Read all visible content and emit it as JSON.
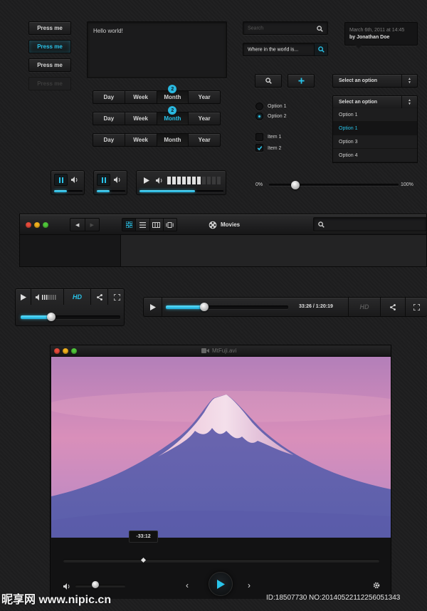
{
  "buttons": {
    "b1": "Press me",
    "b2": "Press me",
    "b3": "Press me",
    "b4": "Press me"
  },
  "textarea": {
    "value": "Hello world!"
  },
  "segmented": [
    {
      "items": [
        "Day",
        "Week",
        "Month",
        "Year"
      ],
      "badge": "2"
    },
    {
      "items": [
        "Day",
        "Week",
        "Month",
        "Year"
      ],
      "badge": "2"
    },
    {
      "items": [
        "Day",
        "Week",
        "Month",
        "Year"
      ]
    }
  ],
  "search": {
    "placeholder": "Search",
    "value": "Where in the world is..."
  },
  "tooltip": {
    "date": "March 6th, 2011 at 14:45",
    "author": "by Jonathan Doe"
  },
  "selects": {
    "closed": "Select an option",
    "open": "Select an option",
    "options": [
      "Option 1",
      "Option 1",
      "Option 3",
      "Option 4"
    ],
    "selected_index": 1
  },
  "radios": [
    "Option 1",
    "Option 2"
  ],
  "checkboxes": [
    "Item 1",
    "Item 2"
  ],
  "slider": {
    "min_label": "0%",
    "max_label": "100%",
    "value": 0.12
  },
  "finder": {
    "title": "Movies"
  },
  "players": {
    "hd_label": "HD",
    "hd_label_2": "HD",
    "time": "33:26 / 1:20:19",
    "progress_small": 0.72,
    "progress_large": 0.32
  },
  "video": {
    "filename": "MtFuji.avi",
    "tooltip_time": "-33:12",
    "volume": 0.35
  },
  "watermark": {
    "logo": "昵享网 www.nipic.cn",
    "id": "ID:18507730 NO:20140522112256051343"
  },
  "colors": {
    "accent": "#29c4ea",
    "bg": "#1e1e1f"
  }
}
